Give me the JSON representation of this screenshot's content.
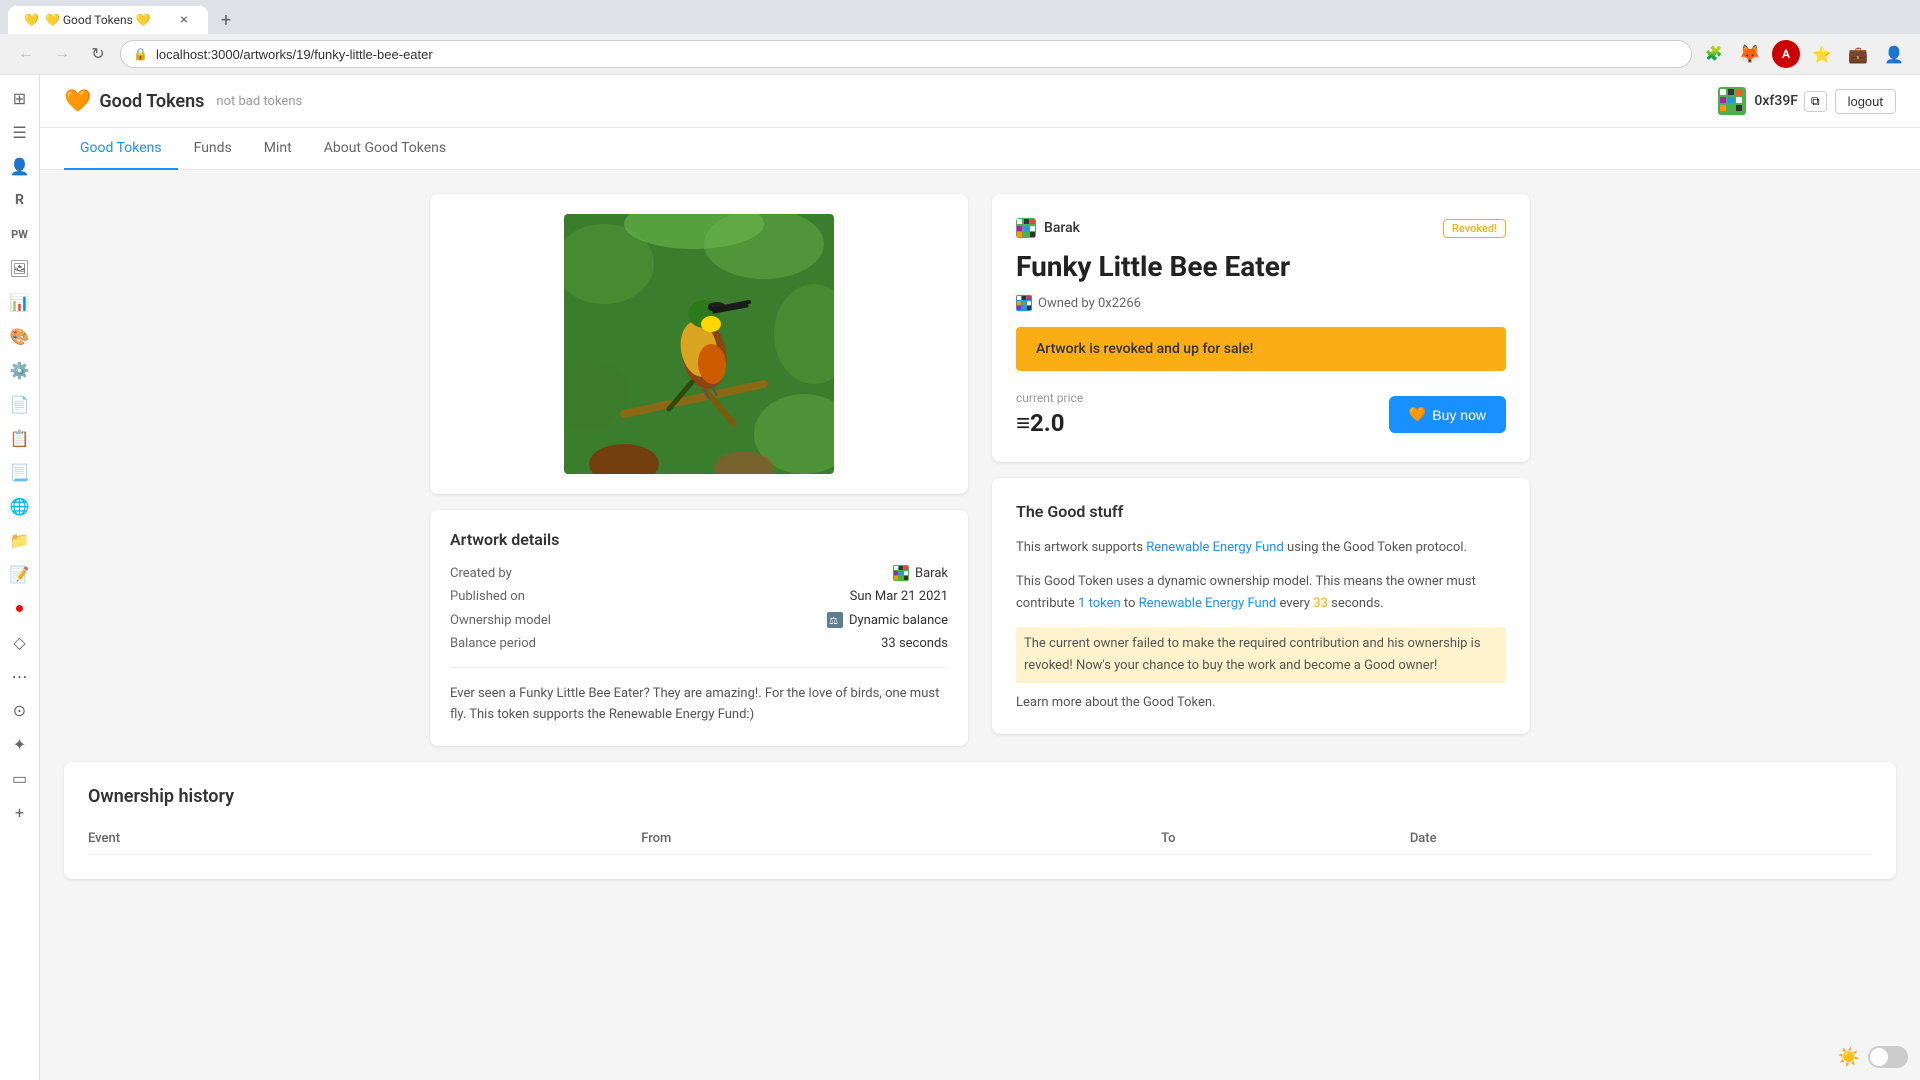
{
  "browser": {
    "tab_favicon": "🧡",
    "tab_title": "💛 Good Tokens 💛",
    "url": "localhost:3000/artworks/19/funky-little-bee-eater",
    "back_disabled": false,
    "forward_disabled": true
  },
  "header": {
    "logo_emoji": "🧡",
    "app_name": "Good Tokens",
    "tagline": "not bad tokens",
    "wallet_address": "0xf39F",
    "logout_label": "logout"
  },
  "nav": {
    "tabs": [
      {
        "label": "Good Tokens",
        "active": true
      },
      {
        "label": "Funds",
        "active": false
      },
      {
        "label": "Mint",
        "active": false
      },
      {
        "label": "About Good Tokens",
        "active": false
      }
    ]
  },
  "artwork": {
    "creator_name": "Barak",
    "status_badge": "Revoked!",
    "title": "Funky Little Bee Eater",
    "owner_label": "Owned by 0x2266",
    "revoked_banner": "Artwork is revoked and up for sale!",
    "current_price_label": "current price",
    "price": "≡2.0",
    "buy_button_label": "Buy now",
    "buy_button_emoji": "🧡",
    "details": {
      "section_title": "Artwork details",
      "created_by_label": "Created by",
      "created_by_value": "Barak",
      "published_on_label": "Published on",
      "published_on_value": "Sun Mar 21 2021",
      "ownership_model_label": "Ownership model",
      "ownership_model_value": "Dynamic balance",
      "balance_period_label": "Balance period",
      "balance_period_value": "33 seconds"
    },
    "description": "Ever seen a Funky Little Bee Eater? They are amazing!. For the love of birds, one must fly. This token supports the Renewable Energy Fund:)"
  },
  "good_stuff": {
    "title": "The Good stuff",
    "paragraph1_before": "This artwork supports ",
    "fund_link": "Renewable Energy Fund",
    "paragraph1_after": " using the Good Token protocol.",
    "paragraph2_before": "This Good Token uses a dynamic ownership model. This means the owner must contribute ",
    "token_amount": "1 token",
    "paragraph2_to": " to ",
    "fund_link2": "Renewable Energy Fund",
    "paragraph2_every": " every ",
    "period": "33",
    "paragraph2_after": " seconds.",
    "highlighted": "The current owner failed to make the required contribution and his ownership is revoked! Now's your chance to buy the work and become a Good owner!",
    "learn_more": "Learn more about the Good Token."
  },
  "ownership_history": {
    "title": "Ownership history",
    "columns": [
      "Event",
      "From",
      "To",
      "Date"
    ]
  },
  "bottom": {
    "theme_icon": "☀️"
  }
}
